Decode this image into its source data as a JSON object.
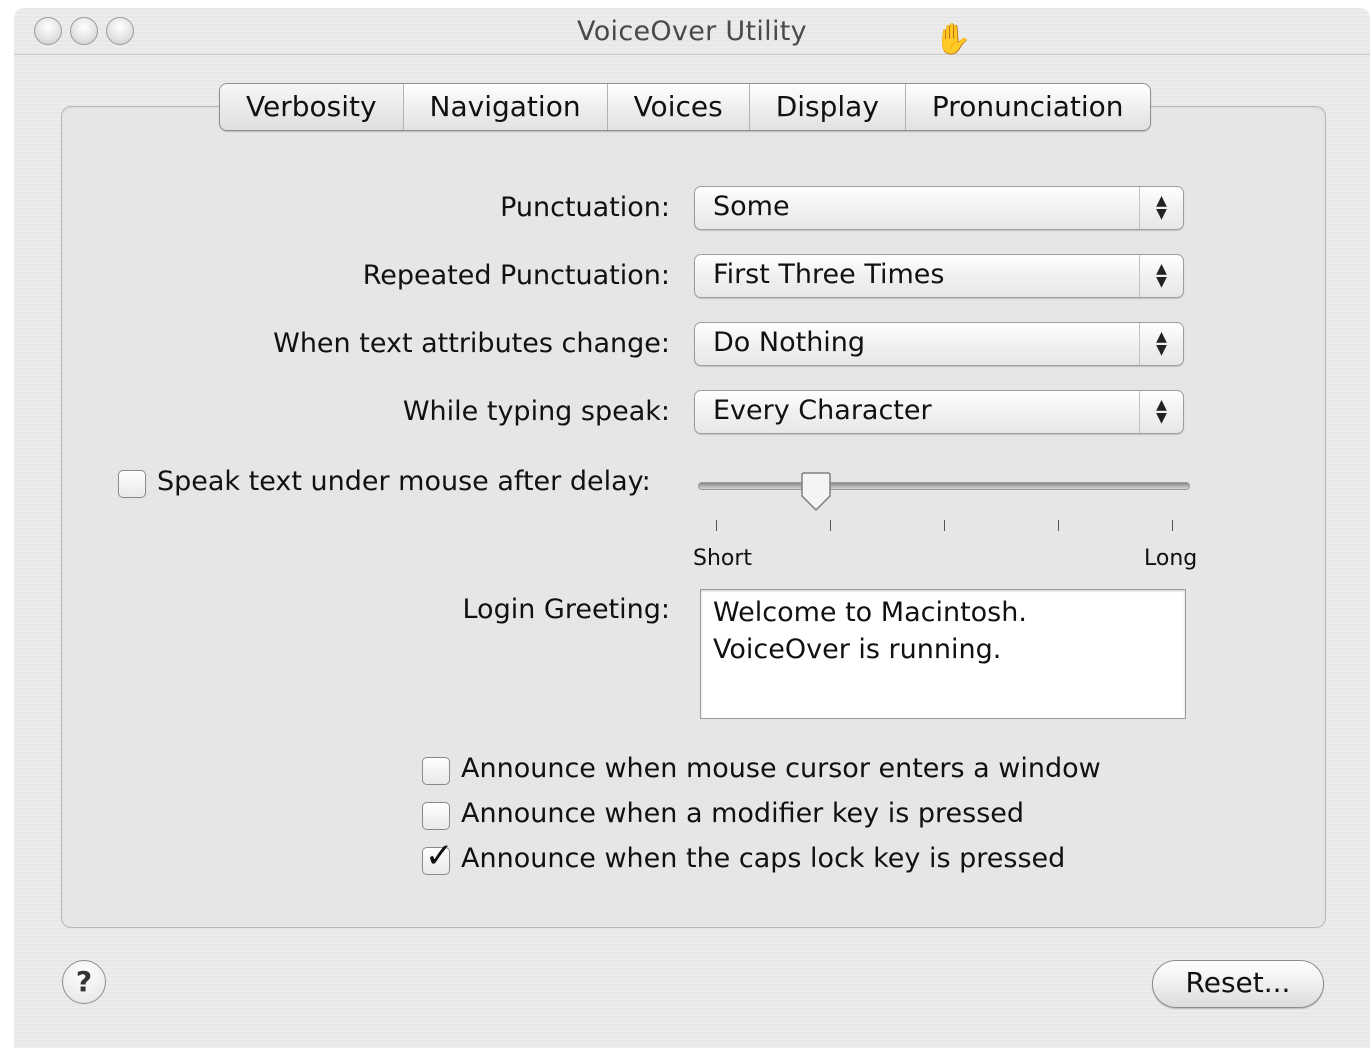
{
  "window": {
    "title": "VoiceOver Utility"
  },
  "tabs": [
    {
      "label": "Verbosity",
      "selected": true
    },
    {
      "label": "Navigation",
      "selected": false
    },
    {
      "label": "Voices",
      "selected": false
    },
    {
      "label": "Display",
      "selected": false
    },
    {
      "label": "Pronunciation",
      "selected": false
    }
  ],
  "settings": {
    "punctuation": {
      "label": "Punctuation:",
      "value": "Some"
    },
    "repeated_punctuation": {
      "label": "Repeated Punctuation:",
      "value": "First Three Times"
    },
    "text_attributes": {
      "label": "When text attributes change:",
      "value": "Do Nothing"
    },
    "typing_speak": {
      "label": "While typing speak:",
      "value": "Every Character"
    }
  },
  "mouse_delay": {
    "label": "Speak text under mouse after delay:",
    "checked": false,
    "slider_fraction": 0.22,
    "min_label": "Short",
    "max_label": "Long",
    "tick_count": 5
  },
  "login_greeting": {
    "label": "Login Greeting:",
    "line1": "Welcome to Macintosh.",
    "line2": "VoiceOver is running."
  },
  "announce": [
    {
      "label": "Announce when mouse cursor enters a window",
      "checked": false
    },
    {
      "label": "Announce when a modifier key is pressed",
      "checked": false
    },
    {
      "label": "Announce when the caps lock key is pressed",
      "checked": true
    }
  ],
  "buttons": {
    "help": "?",
    "reset": "Reset..."
  },
  "icons": {
    "cursor": "open-hand-icon",
    "popup": "up-down-arrows-icon",
    "checkmark": "checkmark-icon"
  }
}
